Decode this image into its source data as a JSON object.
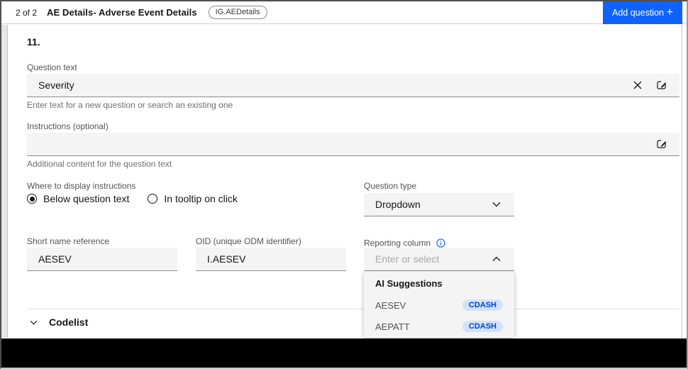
{
  "header": {
    "page_indicator": "2 of 2",
    "title": "AE Details- Adverse Event Details",
    "tag": "IG.AEDetails",
    "add_question_label": "Add question",
    "add_question_plus": "+"
  },
  "form": {
    "question_number": "11.",
    "question_text": {
      "label": "Question text",
      "value": "Severity",
      "helper": "Enter text for a new question or search an existing one"
    },
    "instructions": {
      "label": "Instructions (optional)",
      "value": "",
      "helper": "Additional content for the question text"
    },
    "display_instructions": {
      "label": "Where to display instructions",
      "options": [
        {
          "label": "Below question text",
          "selected": true
        },
        {
          "label": "In tooltip on click",
          "selected": false
        }
      ]
    },
    "question_type": {
      "label": "Question type",
      "value": "Dropdown"
    },
    "short_name": {
      "label": "Short name reference",
      "value": "AESEV"
    },
    "oid": {
      "label": "OID (unique ODM identifier)",
      "value": "I.AESEV"
    },
    "reporting_column": {
      "label": "Reporting column",
      "placeholder": "Enter or select",
      "dropdown": {
        "group_label": "AI Suggestions",
        "items": [
          {
            "label": "AESEV",
            "tag": "CDASH"
          },
          {
            "label": "AEPATT",
            "tag": "CDASH"
          }
        ]
      }
    },
    "codelist": {
      "label": "Codelist"
    }
  },
  "colors": {
    "accent": "#0f62fe",
    "tag_bg": "#d0e2ff",
    "tag_text": "#0043ce",
    "field_bg": "#f4f4f4"
  }
}
